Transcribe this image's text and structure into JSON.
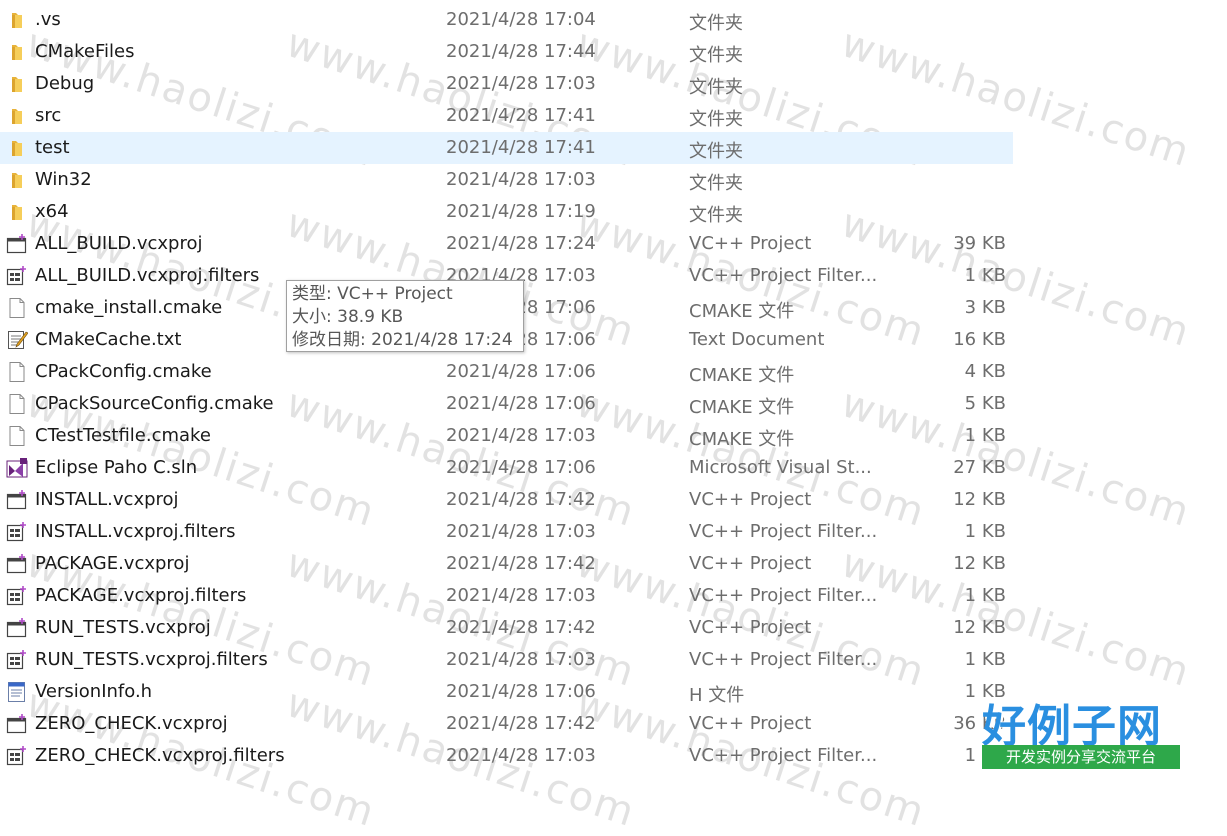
{
  "files": [
    {
      "name": ".vs",
      "date": "2021/4/28 17:04",
      "type": "文件夹",
      "size": "",
      "icon": "folder-icon"
    },
    {
      "name": "CMakeFiles",
      "date": "2021/4/28 17:44",
      "type": "文件夹",
      "size": "",
      "icon": "folder-icon"
    },
    {
      "name": "Debug",
      "date": "2021/4/28 17:03",
      "type": "文件夹",
      "size": "",
      "icon": "folder-icon"
    },
    {
      "name": "src",
      "date": "2021/4/28 17:41",
      "type": "文件夹",
      "size": "",
      "icon": "folder-icon"
    },
    {
      "name": "test",
      "date": "2021/4/28 17:41",
      "type": "文件夹",
      "size": "",
      "icon": "folder-icon",
      "selected": true
    },
    {
      "name": "Win32",
      "date": "2021/4/28 17:03",
      "type": "文件夹",
      "size": "",
      "icon": "folder-icon"
    },
    {
      "name": "x64",
      "date": "2021/4/28 17:19",
      "type": "文件夹",
      "size": "",
      "icon": "folder-icon"
    },
    {
      "name": "ALL_BUILD.vcxproj",
      "date": "2021/4/28 17:24",
      "type": "VC++ Project",
      "size": "39 KB",
      "icon": "vcxproj-icon"
    },
    {
      "name": "ALL_BUILD.vcxproj.filters",
      "date": "2021/4/28 17:03",
      "type": "VC++ Project Filter...",
      "size": "1 KB",
      "icon": "filters-icon"
    },
    {
      "name": "cmake_install.cmake",
      "date": "2021/4/28 17:06",
      "type": "CMAKE 文件",
      "size": "3 KB",
      "icon": "file-icon"
    },
    {
      "name": "CMakeCache.txt",
      "date": "2021/4/28 17:06",
      "type": "Text Document",
      "size": "16 KB",
      "icon": "text-document-icon"
    },
    {
      "name": "CPackConfig.cmake",
      "date": "2021/4/28 17:06",
      "type": "CMAKE 文件",
      "size": "4 KB",
      "icon": "file-icon"
    },
    {
      "name": "CPackSourceConfig.cmake",
      "date": "2021/4/28 17:06",
      "type": "CMAKE 文件",
      "size": "5 KB",
      "icon": "file-icon"
    },
    {
      "name": "CTestTestfile.cmake",
      "date": "2021/4/28 17:03",
      "type": "CMAKE 文件",
      "size": "1 KB",
      "icon": "file-icon"
    },
    {
      "name": "Eclipse Paho C.sln",
      "date": "2021/4/28 17:06",
      "type": "Microsoft Visual St...",
      "size": "27 KB",
      "icon": "visual-studio-solution-icon"
    },
    {
      "name": "INSTALL.vcxproj",
      "date": "2021/4/28 17:42",
      "type": "VC++ Project",
      "size": "12 KB",
      "icon": "vcxproj-icon"
    },
    {
      "name": "INSTALL.vcxproj.filters",
      "date": "2021/4/28 17:03",
      "type": "VC++ Project Filter...",
      "size": "1 KB",
      "icon": "filters-icon"
    },
    {
      "name": "PACKAGE.vcxproj",
      "date": "2021/4/28 17:42",
      "type": "VC++ Project",
      "size": "12 KB",
      "icon": "vcxproj-icon"
    },
    {
      "name": "PACKAGE.vcxproj.filters",
      "date": "2021/4/28 17:03",
      "type": "VC++ Project Filter...",
      "size": "1 KB",
      "icon": "filters-icon"
    },
    {
      "name": "RUN_TESTS.vcxproj",
      "date": "2021/4/28 17:42",
      "type": "VC++ Project",
      "size": "12 KB",
      "icon": "vcxproj-icon"
    },
    {
      "name": "RUN_TESTS.vcxproj.filters",
      "date": "2021/4/28 17:03",
      "type": "VC++ Project Filter...",
      "size": "1 KB",
      "icon": "filters-icon"
    },
    {
      "name": "VersionInfo.h",
      "date": "2021/4/28 17:06",
      "type": "H 文件",
      "size": "1 KB",
      "icon": "header-file-icon"
    },
    {
      "name": "ZERO_CHECK.vcxproj",
      "date": "2021/4/28 17:42",
      "type": "VC++ Project",
      "size": "36 KB",
      "icon": "vcxproj-icon"
    },
    {
      "name": "ZERO_CHECK.vcxproj.filters",
      "date": "2021/4/28 17:03",
      "type": "VC++ Project Filter...",
      "size": "1 KB",
      "icon": "filters-icon"
    }
  ],
  "tooltip": {
    "type_line": "类型: VC++ Project",
    "size_line": "大小: 38.9 KB",
    "date_line": "修改日期: 2021/4/28 17:24"
  },
  "watermark": {
    "text": "www.haolizi.com"
  },
  "logo": {
    "title": "好例子网",
    "subtitle": "开发实例分享交流平台"
  },
  "colors": {
    "selection": "#e5f3ff",
    "folder": "#f3c64c",
    "vs_purple": "#68217a",
    "logo_blue": "#2a8fe0",
    "logo_green": "#2ea84a"
  }
}
